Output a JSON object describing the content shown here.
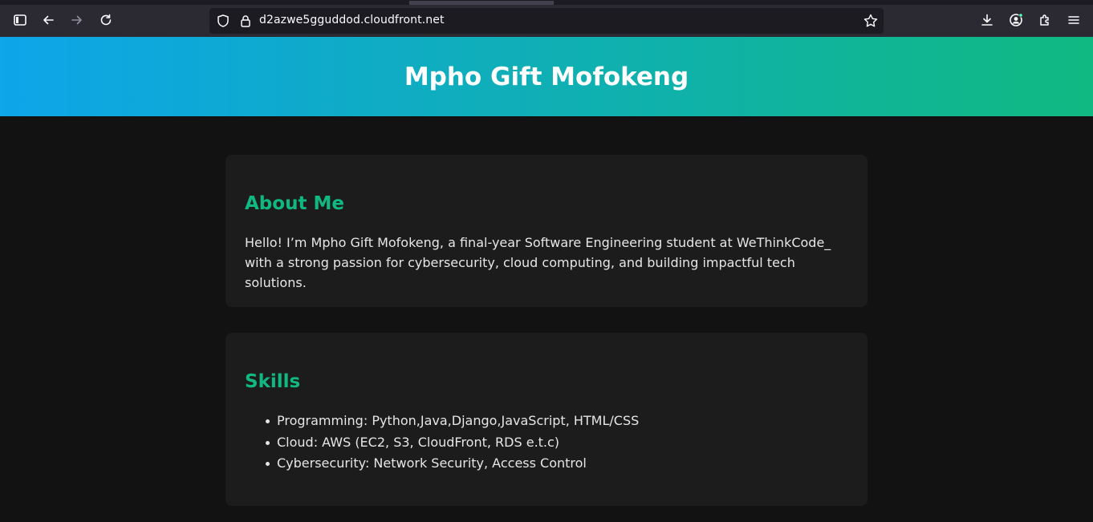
{
  "browser": {
    "url": "d2azwe5gguddod.cloudfront.net",
    "icons": {
      "sidebar": "sidebar-icon",
      "back": "back-arrow-icon",
      "forward": "forward-arrow-icon",
      "reload": "reload-icon",
      "shield": "shield-icon",
      "lock": "lock-icon",
      "bookmark": "star-icon",
      "downloads": "download-icon",
      "account": "account-icon",
      "extensions": "extensions-icon",
      "menu": "hamburger-menu-icon"
    }
  },
  "header": {
    "name": "Mpho Gift Mofokeng",
    "gradient_start": "#0ea5e9",
    "gradient_end": "#10b981"
  },
  "about": {
    "title": "About Me",
    "text": "Hello! I’m Mpho Gift Mofokeng, a final-year Software Engineering student at WeThinkCode_ with a strong passion for cybersecurity, cloud computing, and building impactful tech solutions."
  },
  "skills": {
    "title": "Skills",
    "items": [
      "Programming: Python,Java,Django,JavaScript, HTML/CSS",
      "Cloud: AWS (EC2, S3, CloudFront, RDS e.t.c)",
      "Cybersecurity: Network Security, Access Control"
    ]
  },
  "colors": {
    "accent": "#10b981",
    "background": "#121212",
    "card": "#1c1c1c"
  }
}
